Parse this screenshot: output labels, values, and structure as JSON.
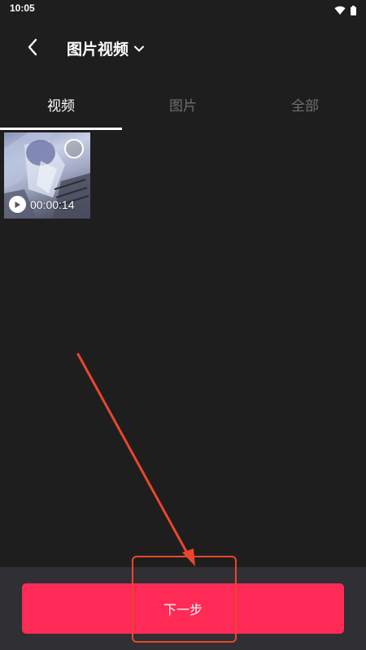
{
  "status_bar": {
    "time": "10:05",
    "icons": [
      "wifi-icon",
      "battery-icon"
    ]
  },
  "header": {
    "back_icon": "chevron-left-icon",
    "title": "图片视频",
    "title_dropdown_icon": "chevron-down-icon"
  },
  "tabs": [
    {
      "label": "视频",
      "active": true
    },
    {
      "label": "图片",
      "active": false
    },
    {
      "label": "全部",
      "active": false
    }
  ],
  "media_items": [
    {
      "type": "video",
      "duration": "00:00:14",
      "selected": false
    }
  ],
  "footer": {
    "next_label": "下一步"
  },
  "colors": {
    "background": "#1e1e1e",
    "bottom_bar": "#2f2f34",
    "primary": "#ff2a55",
    "tab_inactive": "#6f6f6f",
    "annotation": "#e8472d"
  }
}
